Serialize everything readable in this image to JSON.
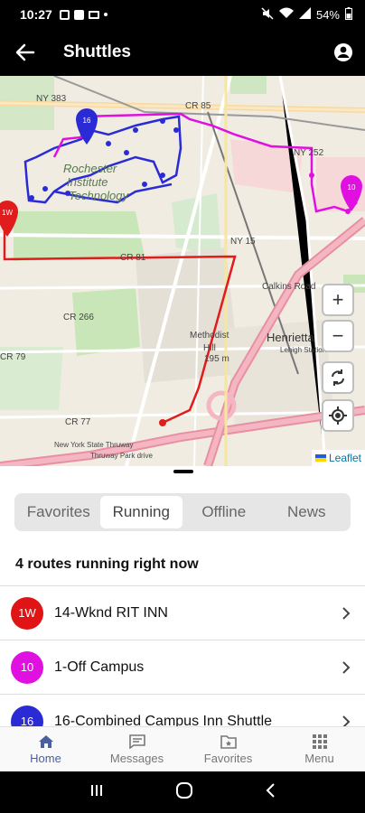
{
  "status": {
    "time": "10:27",
    "battery": "54%"
  },
  "header": {
    "title": "Shuttles"
  },
  "map": {
    "labels": {
      "ny383": "NY 383",
      "cr85": "CR 85",
      "ny252": "NY 252",
      "rit_line1": "Rochester",
      "rit_line2": "Institute",
      "rit_line3": "Technology",
      "cr81": "CR 81",
      "ny15": "NY 15",
      "cr266": "CR 266",
      "calkins": "Calkins Road",
      "methodist1": "Methodist",
      "methodist2": "Hill",
      "elev": "195 m",
      "henrietta": "Henrietta",
      "cr79": "CR 79",
      "cr77": "CR 77",
      "i90": "New York State Thruway",
      "i90b": "Thruway Park drive",
      "le": "Lehigh Station Road"
    },
    "zoom_in": "+",
    "zoom_out": "−",
    "attribution": "Leaflet",
    "colors": {
      "blue": "#2b2bd6",
      "magenta": "#e010e0",
      "red": "#e01c1c"
    }
  },
  "tabs": [
    "Favorites",
    "Running",
    "Offline",
    "News"
  ],
  "active_tab": "Running",
  "routes_heading": "4 routes running right now",
  "routes": [
    {
      "badge": "1W",
      "name": "14-Wknd RIT INN",
      "color": "#e01414"
    },
    {
      "badge": "10",
      "name": "1-Off Campus",
      "color": "#e010e0"
    },
    {
      "badge": "16",
      "name": "16-Combined Campus Inn Shuttle",
      "color": "#2b2bd6"
    }
  ],
  "nav": {
    "home": "Home",
    "messages": "Messages",
    "favorites": "Favorites",
    "menu": "Menu"
  }
}
